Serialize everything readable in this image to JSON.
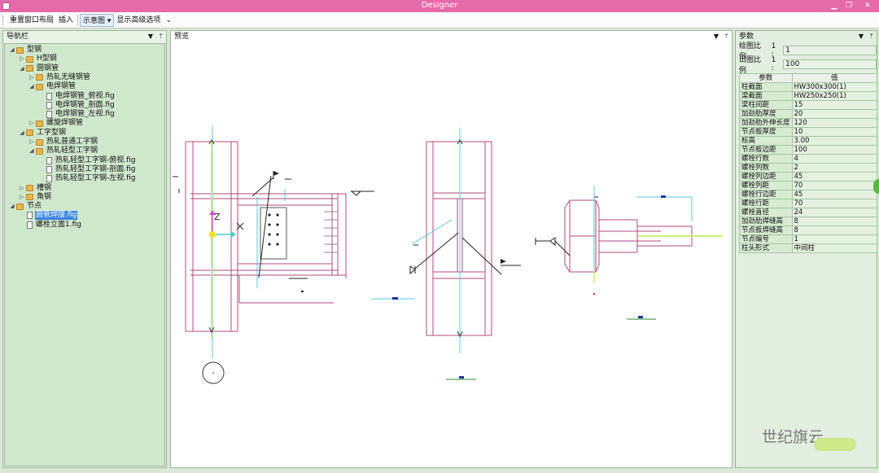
{
  "window": {
    "title": "Designer"
  },
  "menu": {
    "items": [
      "重置窗口布局",
      "插入",
      "示意图 ▾",
      "显示高级选项"
    ]
  },
  "nav": {
    "title": "导航栏",
    "tree": [
      {
        "label": "型钢",
        "level": 0,
        "type": "folder",
        "toggle": "◢"
      },
      {
        "label": "H型钢",
        "level": 1,
        "type": "folder",
        "toggle": "▷"
      },
      {
        "label": "圆钢管",
        "level": 1,
        "type": "folder",
        "toggle": "◢"
      },
      {
        "label": "热轧无缝钢管",
        "level": 2,
        "type": "folder",
        "toggle": "▷"
      },
      {
        "label": "电焊钢管",
        "level": 2,
        "type": "folder",
        "toggle": "◢"
      },
      {
        "label": "电焊钢管_俯视.fig",
        "level": 3,
        "type": "file",
        "toggle": ""
      },
      {
        "label": "电焊钢管_剖面.fig",
        "level": 3,
        "type": "file",
        "toggle": ""
      },
      {
        "label": "电焊钢管_左视.fig",
        "level": 3,
        "type": "file",
        "toggle": ""
      },
      {
        "label": "螺旋焊钢管",
        "level": 2,
        "type": "folder",
        "toggle": "▷"
      },
      {
        "label": "工字型钢",
        "level": 1,
        "type": "folder",
        "toggle": "◢"
      },
      {
        "label": "热轧普通工字钢",
        "level": 2,
        "type": "folder",
        "toggle": "▷"
      },
      {
        "label": "热轧轻型工字钢",
        "level": 2,
        "type": "folder",
        "toggle": "◢"
      },
      {
        "label": "热轧轻型工字钢-俯视.fig",
        "level": 3,
        "type": "file",
        "toggle": ""
      },
      {
        "label": "热轧轻型工字钢-剖面.fig",
        "level": 3,
        "type": "file",
        "toggle": ""
      },
      {
        "label": "热轧轻型工字钢-左视.fig",
        "level": 3,
        "type": "file",
        "toggle": ""
      },
      {
        "label": "槽钢",
        "level": 1,
        "type": "folder",
        "toggle": "▷"
      },
      {
        "label": "角钢",
        "level": 1,
        "type": "folder",
        "toggle": "▷"
      },
      {
        "label": "节点",
        "level": 0,
        "type": "folder",
        "toggle": "◢"
      },
      {
        "label": "圆管焊接.fig",
        "level": 1,
        "type": "file",
        "toggle": "",
        "selected": true
      },
      {
        "label": "螺栓立面1.fig",
        "level": 1,
        "type": "file",
        "toggle": ""
      }
    ]
  },
  "preview": {
    "title": "预览",
    "axis_label": "Z"
  },
  "params": {
    "title": "参数",
    "draw_scale": {
      "label": "绘图比例",
      "prefix": "1 :",
      "value": "1"
    },
    "out_scale": {
      "label": "出图比例",
      "prefix": "1 :",
      "value": "100"
    },
    "table_headers": [
      "参数",
      "值"
    ],
    "rows": [
      [
        "柱截面",
        "HW300x300(1)"
      ],
      [
        "梁截面",
        "HW250x250(1)"
      ],
      [
        "梁柱间距",
        "15"
      ],
      [
        "加劲肋厚度",
        "20"
      ],
      [
        "加劲肋外伸长度",
        "120"
      ],
      [
        "节点板厚度",
        "10"
      ],
      [
        "标高",
        "3.00"
      ],
      [
        "节点板边距",
        "100"
      ],
      [
        "螺栓行数",
        "4"
      ],
      [
        "螺栓列数",
        "2"
      ],
      [
        "螺栓列边距",
        "45"
      ],
      [
        "螺栓列距",
        "70"
      ],
      [
        "螺栓行边距",
        "45"
      ],
      [
        "螺栓行距",
        "70"
      ],
      [
        "螺栓直径",
        "24"
      ],
      [
        "加劲肋焊缝高",
        "8"
      ],
      [
        "节点板焊缝高",
        "8"
      ],
      [
        "节点编号",
        "1"
      ],
      [
        "柱头形式",
        "中间柱"
      ]
    ]
  },
  "watermark": {
    "text": "世纪旗云"
  },
  "colors": {
    "title_bar": "#e66aa8",
    "panel_bg": "#cfe7cc",
    "selection": "#3a86e0"
  }
}
